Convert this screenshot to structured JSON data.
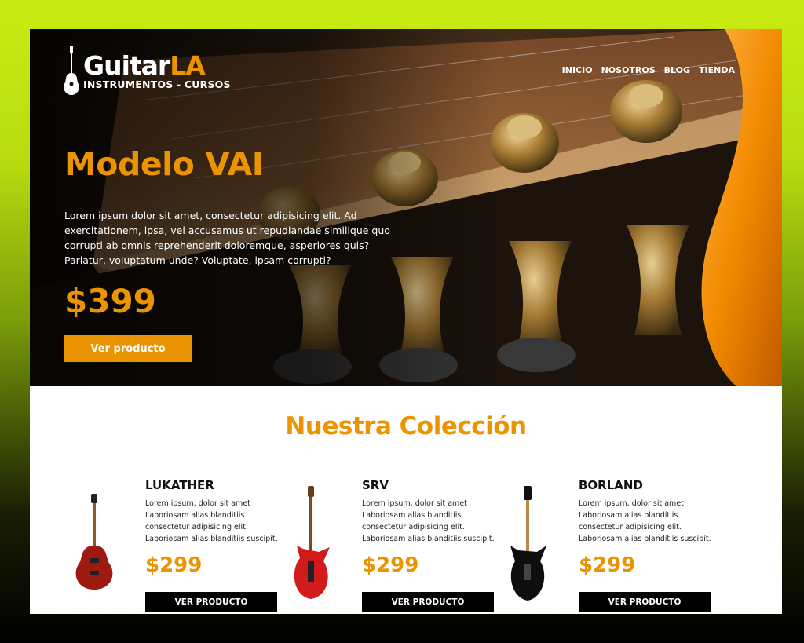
{
  "brand": {
    "title_part1": "Guitar",
    "title_part2": "LA",
    "subtitle": "INSTRUMENTOS - CURSOS"
  },
  "nav": [
    {
      "label": "INICIO"
    },
    {
      "label": "NOSOTROS"
    },
    {
      "label": "BLOG"
    },
    {
      "label": "TIENDA"
    }
  ],
  "hero": {
    "title": "Modelo VAI",
    "text": "Lorem ipsum dolor sit amet, consectetur adipisicing elit. Ad exercitationem, ipsa, vel accusamus ut repudiandae similique quo corrupti ab omnis reprehenderit doloremque, asperiores quis? Pariatur, voluptatum unde? Voluptate, ipsam corrupti?",
    "price": "$399",
    "button": "Ver producto"
  },
  "collection": {
    "title": "Nuestra Colección",
    "products": [
      {
        "name": "LUKATHER",
        "desc": "Lorem ipsum, dolor sit amet Laboriosam alias blanditiis consectetur adipisicing elit. Laboriosam alias blanditiis suscipit.",
        "price": "$299",
        "button": "VER PRODUCTO"
      },
      {
        "name": "SRV",
        "desc": "Lorem ipsum, dolor sit amet Laboriosam alias blanditiis consectetur adipisicing elit. Laboriosam alias blanditiis suscipit.",
        "price": "$299",
        "button": "VER PRODUCTO"
      },
      {
        "name": "BORLAND",
        "desc": "Lorem ipsum, dolor sit amet Laboriosam alias blanditiis consectetur adipisicing elit. Laboriosam alias blanditiis suscipit.",
        "price": "$299",
        "button": "VER PRODUCTO"
      }
    ]
  },
  "colors": {
    "accent": "#e99400",
    "dark": "#000000",
    "frame_bg": "#c8ec12"
  }
}
